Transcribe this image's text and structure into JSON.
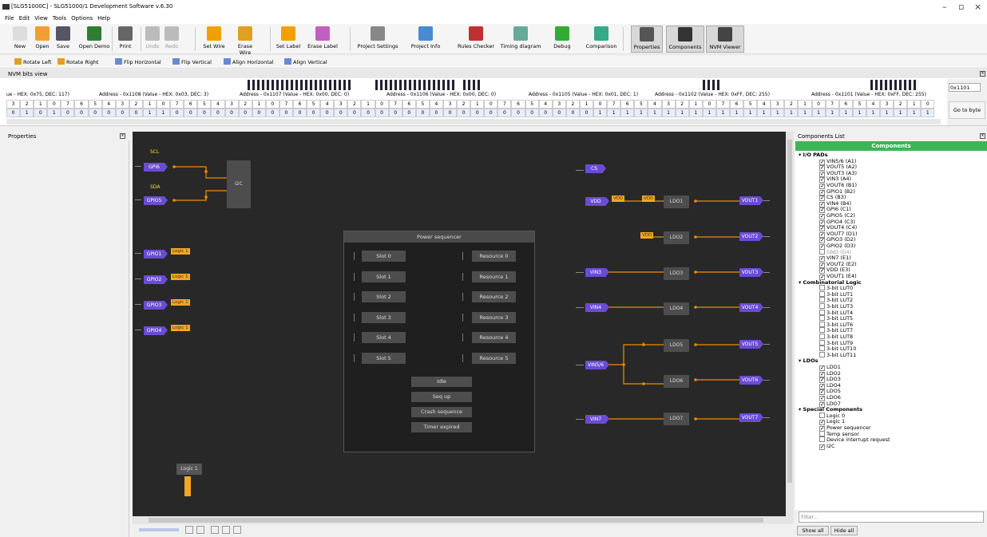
{
  "window": {
    "title": "[SLG51000C] - SLG51000/1 Development Software v.6.30"
  },
  "menu": [
    "File",
    "Edit",
    "View",
    "Tools",
    "Options",
    "Help"
  ],
  "toolbar": [
    {
      "label": "New",
      "icon": "new-file-icon",
      "color": "#ddd"
    },
    {
      "label": "Open",
      "icon": "open-folder-icon",
      "color": "#f0a030"
    },
    {
      "label": "Save",
      "icon": "save-icon",
      "color": "#556"
    },
    {
      "label": "Open Demo",
      "icon": "demo-chip-icon",
      "color": "#2e7d32"
    },
    {
      "label": "Print",
      "icon": "print-icon",
      "color": "#666"
    },
    {
      "label": "Undo",
      "icon": "undo-icon",
      "color": "#bbb"
    },
    {
      "label": "Redo",
      "icon": "redo-icon",
      "color": "#bbb"
    },
    {
      "label": "Set Wire",
      "icon": "set-wire-icon",
      "color": "#f0a000"
    },
    {
      "label": "Erase Wire",
      "icon": "erase-wire-icon",
      "color": "#e0a020"
    },
    {
      "label": "Set Label",
      "icon": "set-label-icon",
      "color": "#f0a000"
    },
    {
      "label": "Erase Label",
      "icon": "erase-label-icon",
      "color": "#c060c0"
    },
    {
      "label": "Project Settings",
      "icon": "tools-icon",
      "color": "#888"
    },
    {
      "label": "Project Info",
      "icon": "info-icon",
      "color": "#4a8ad0"
    },
    {
      "label": "Rules Checker",
      "icon": "bug-icon",
      "color": "#c03030"
    },
    {
      "label": "Timing diagram",
      "icon": "chart-icon",
      "color": "#6a9"
    },
    {
      "label": "Debug",
      "icon": "debug-icon",
      "color": "#3a3"
    },
    {
      "label": "Comparison",
      "icon": "compare-icon",
      "color": "#3a8"
    },
    {
      "label": "Properties",
      "icon": "properties-icon",
      "color": "#555"
    },
    {
      "label": "Components",
      "icon": "components-icon",
      "color": "#333"
    },
    {
      "label": "NVM Viewer",
      "icon": "nvm-icon",
      "color": "#444"
    }
  ],
  "toolbar2": [
    "Rotate Left",
    "Rotate Right",
    "Flip Horizontal",
    "Flip Vertical",
    "Align Horizontal",
    "Align Vertical"
  ],
  "nvm": {
    "title": "NVM bits view",
    "addresses": [
      "ue - HEX: 0x75, DEC: 117)",
      "Address - 0x1108 (Value - HEX: 0x03, DEC: 3)",
      "Address - 0x1107 (Value - HEX: 0x00, DEC: 0)",
      "Address - 0x1106 (Value - HEX: 0x00, DEC: 0)",
      "Address - 0x1105 (Value - HEX: 0x01, DEC: 1)",
      "Address - 0x1102 (Value - HEX: 0xFF, DEC: 255)",
      "Address - 0x1101 (Value - HEX: 0xFF, DEC: 255)"
    ],
    "bit_index": [
      "3",
      "2",
      "1",
      "0",
      "7",
      "6",
      "5",
      "4",
      "3",
      "2",
      "1",
      "0",
      "7",
      "6",
      "5",
      "4",
      "3",
      "2",
      "1",
      "0",
      "7",
      "6",
      "5",
      "4",
      "3",
      "2",
      "1",
      "0",
      "7",
      "6",
      "5",
      "4",
      "3",
      "2",
      "1",
      "0",
      "7",
      "6",
      "5",
      "4",
      "3",
      "2",
      "1",
      "0",
      "7",
      "6",
      "5",
      "4",
      "3",
      "2",
      "1",
      "0",
      "7",
      "6",
      "5",
      "4",
      "3",
      "2",
      "1",
      "0",
      "7",
      "6",
      "5",
      "4",
      "3",
      "2",
      "1",
      "0"
    ],
    "bit_values": [
      "0",
      "1",
      "0",
      "1",
      "0",
      "0",
      "0",
      "0",
      "0",
      "0",
      "1",
      "1",
      "0",
      "0",
      "0",
      "0",
      "0",
      "0",
      "0",
      "0",
      "0",
      "0",
      "0",
      "0",
      "0",
      "0",
      "0",
      "0",
      "0",
      "0",
      "0",
      "0",
      "0",
      "0",
      "0",
      "0",
      "0",
      "0",
      "0",
      "0",
      "0",
      "0",
      "0",
      "1",
      "1",
      "1",
      "1",
      "1",
      "1",
      "1",
      "1",
      "1",
      "1",
      "1",
      "1",
      "1",
      "1",
      "1",
      "1",
      "1",
      "1",
      "1",
      "1",
      "1",
      "1",
      "1",
      "1",
      "1"
    ],
    "address_input": "0x1101",
    "goto_label": "Go to byte"
  },
  "panels": {
    "properties": "Properties",
    "components_list": "Components List",
    "components_header": "Components"
  },
  "canvas": {
    "signals": {
      "scl": "SCL",
      "sda": "SDA"
    },
    "i2c": "I2C",
    "left_pads": [
      "GPI6",
      "GPIO5",
      "GPIO1",
      "GPIO2",
      "GPIO3",
      "GPIO4"
    ],
    "logic_label": "Logic 1",
    "logic_block": "Logic 1",
    "right": {
      "cs": "CS",
      "vdd": "VDD",
      "ldo": [
        "LDO1",
        "LDO2",
        "LDO3",
        "LDO4",
        "LDO5",
        "LDO6",
        "LDO7"
      ],
      "vin": [
        "VIN3",
        "VIN4",
        "VIN5/6",
        "VIN7"
      ],
      "vout": [
        "VOUT1",
        "VOUT2",
        "VOUT3",
        "VOUT4",
        "VOUT5",
        "VOUT6",
        "VOUT7"
      ]
    },
    "power_sequencer": {
      "title": "Power sequencer",
      "slots": [
        "Slot 0",
        "Slot 1",
        "Slot 2",
        "Slot 3",
        "Slot 4",
        "Slot 5"
      ],
      "resources": [
        "Resource 0",
        "Resource 1",
        "Resource 2",
        "Resource 3",
        "Resource 4",
        "Resource 5"
      ],
      "states": [
        "Idle",
        "Seq up",
        "Crash sequence",
        "Timer expired"
      ]
    }
  },
  "tree": [
    {
      "t": "g",
      "label": "I/O PADs"
    },
    {
      "t": "i",
      "label": "VIN5/6 (A1)",
      "c": true
    },
    {
      "t": "i",
      "label": "VOUT5 (A2)",
      "c": true
    },
    {
      "t": "i",
      "label": "VOUT3 (A3)",
      "c": true
    },
    {
      "t": "i",
      "label": "VIN3 (A4)",
      "c": true
    },
    {
      "t": "i",
      "label": "VOUT6 (B1)",
      "c": true
    },
    {
      "t": "i",
      "label": "GPIO1 (B2)",
      "c": true
    },
    {
      "t": "i",
      "label": "CS (B3)",
      "c": true
    },
    {
      "t": "i",
      "label": "VIN4 (B4)",
      "c": true
    },
    {
      "t": "i",
      "label": "GPI6 (C1)",
      "c": true
    },
    {
      "t": "i",
      "label": "GPIO5 (C2)",
      "c": true
    },
    {
      "t": "i",
      "label": "GPIO4 (C3)",
      "c": true
    },
    {
      "t": "i",
      "label": "VOUT4 (C4)",
      "c": true
    },
    {
      "t": "i",
      "label": "VOUT7 (D1)",
      "c": true
    },
    {
      "t": "i",
      "label": "GPIO3 (D2)",
      "c": true
    },
    {
      "t": "i",
      "label": "GPIO2 (D3)",
      "c": true
    },
    {
      "t": "i",
      "label": "GND (D4)",
      "c": false,
      "gray": true
    },
    {
      "t": "i",
      "label": "VIN7 (E1)",
      "c": true
    },
    {
      "t": "i",
      "label": "VOUT2 (E2)",
      "c": true
    },
    {
      "t": "i",
      "label": "VDD (E3)",
      "c": true
    },
    {
      "t": "i",
      "label": "VOUT1 (E4)",
      "c": true
    },
    {
      "t": "g",
      "label": "Combinatorial Logic"
    },
    {
      "t": "i",
      "label": "3-bit LUT0",
      "c": false
    },
    {
      "t": "i",
      "label": "3-bit LUT1",
      "c": false
    },
    {
      "t": "i",
      "label": "3-bit LUT2",
      "c": false
    },
    {
      "t": "i",
      "label": "3-bit LUT3",
      "c": false
    },
    {
      "t": "i",
      "label": "3-bit LUT4",
      "c": false
    },
    {
      "t": "i",
      "label": "3-bit LUT5",
      "c": false
    },
    {
      "t": "i",
      "label": "3-bit LUT6",
      "c": false
    },
    {
      "t": "i",
      "label": "3-bit LUT7",
      "c": false
    },
    {
      "t": "i",
      "label": "3-bit LUT8",
      "c": false
    },
    {
      "t": "i",
      "label": "3-bit LUT9",
      "c": false
    },
    {
      "t": "i",
      "label": "3-bit LUT10",
      "c": false
    },
    {
      "t": "i",
      "label": "3-bit LUT11",
      "c": false
    },
    {
      "t": "g",
      "label": "LDOs"
    },
    {
      "t": "i",
      "label": "LDO1",
      "c": true
    },
    {
      "t": "i",
      "label": "LDO2",
      "c": true
    },
    {
      "t": "i",
      "label": "LDO3",
      "c": true
    },
    {
      "t": "i",
      "label": "LDO4",
      "c": true
    },
    {
      "t": "i",
      "label": "LDO5",
      "c": true
    },
    {
      "t": "i",
      "label": "LDO6",
      "c": true
    },
    {
      "t": "i",
      "label": "LDO7",
      "c": true
    },
    {
      "t": "g",
      "label": "Special Components"
    },
    {
      "t": "i",
      "label": "Logic 0",
      "c": false
    },
    {
      "t": "i",
      "label": "Logic 1",
      "c": true
    },
    {
      "t": "i",
      "label": "Power sequencer",
      "c": true
    },
    {
      "t": "i",
      "label": "Temp sensor",
      "c": false
    },
    {
      "t": "i",
      "label": "Device interrupt request",
      "c": false
    },
    {
      "t": "i",
      "label": "I2C",
      "c": true
    }
  ],
  "filter_placeholder": "Filter...",
  "buttons": {
    "show_all": "Show all",
    "hide_all": "Hide all"
  }
}
